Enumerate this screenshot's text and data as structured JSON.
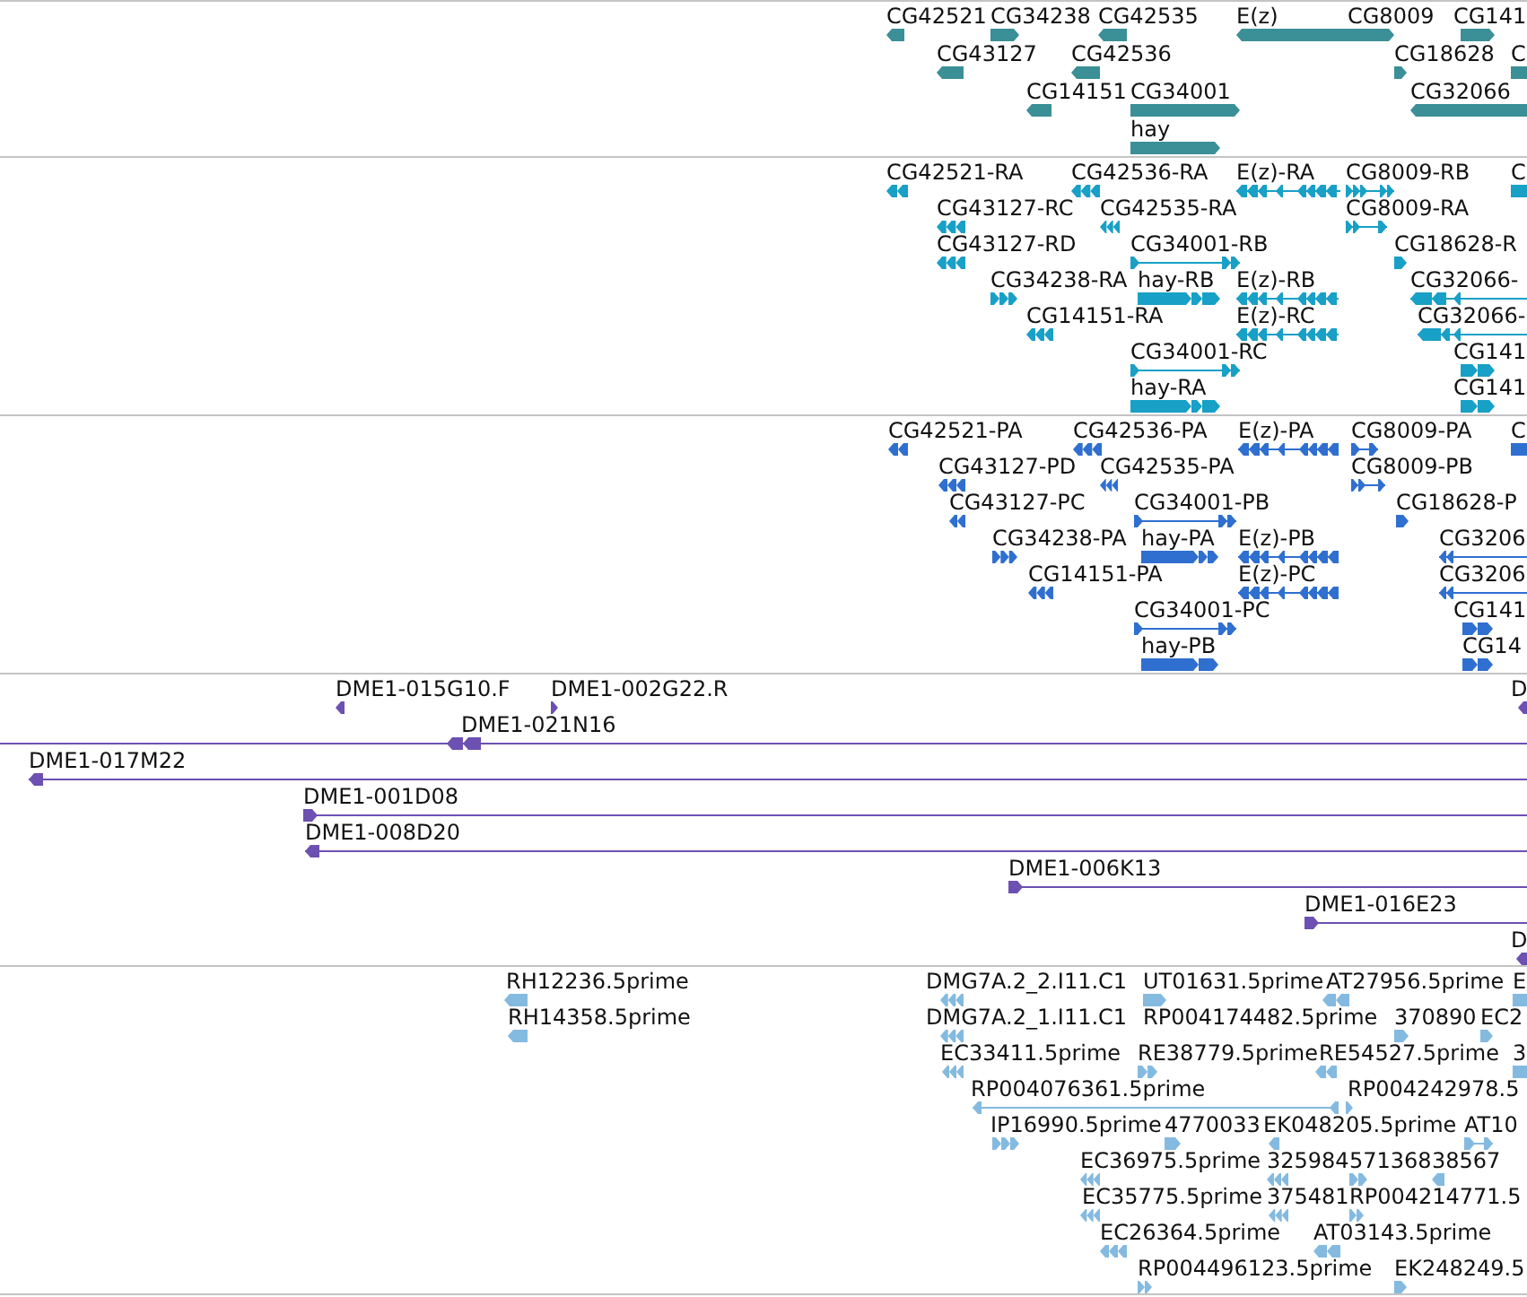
{
  "tracks": [
    {
      "color": "#3b8f96",
      "features": [
        {
          "label": "CG42521",
          "reverse": true
        },
        {
          "label": "CG34238",
          "reverse": false
        },
        {
          "label": "CG42535",
          "reverse": true
        },
        {
          "label": "E(z)",
          "reverse": true
        },
        {
          "label": "CG8009",
          "reverse": false
        },
        {
          "label": "CG141",
          "reverse": false
        },
        {
          "label": "CG43127",
          "reverse": true
        },
        {
          "label": "CG42536",
          "reverse": true
        },
        {
          "label": "CG18628",
          "reverse": false
        },
        {
          "label": "C"
        },
        {
          "label": "CG14151",
          "reverse": true
        },
        {
          "label": "CG34001",
          "reverse": false
        },
        {
          "label": "CG32066",
          "reverse": true
        },
        {
          "label": "hay",
          "reverse": false
        }
      ]
    },
    {
      "color": "#18a0c6",
      "features": [
        {
          "label": "CG42521-RA",
          "reverse": true
        },
        {
          "label": "CG42536-RA",
          "reverse": true
        },
        {
          "label": "E(z)-RA",
          "reverse": true
        },
        {
          "label": "CG8009-RB",
          "reverse": false
        },
        {
          "label": "C"
        },
        {
          "label": "CG43127-RC",
          "reverse": true
        },
        {
          "label": "CG42535-RA",
          "reverse": true
        },
        {
          "label": "CG8009-RA",
          "reverse": false
        },
        {
          "label": "CG43127-RD",
          "reverse": true
        },
        {
          "label": "CG34001-RB",
          "reverse": false
        },
        {
          "label": "CG18628-R",
          "reverse": false
        },
        {
          "label": "CG34238-RA",
          "reverse": false
        },
        {
          "label": "hay-RB",
          "reverse": false
        },
        {
          "label": "E(z)-RB",
          "reverse": true
        },
        {
          "label": "CG32066-",
          "reverse": true
        },
        {
          "label": "CG14151-RA",
          "reverse": true
        },
        {
          "label": "E(z)-RC",
          "reverse": true
        },
        {
          "label": "CG32066-",
          "reverse": true
        },
        {
          "label": "CG34001-RC",
          "reverse": false
        },
        {
          "label": "CG141",
          "reverse": false
        },
        {
          "label": "hay-RA",
          "reverse": false
        },
        {
          "label": "CG141",
          "reverse": false
        }
      ]
    },
    {
      "color": "#2f6fd0",
      "features": [
        {
          "label": "CG42521-PA",
          "reverse": true
        },
        {
          "label": "CG42536-PA",
          "reverse": true
        },
        {
          "label": "E(z)-PA",
          "reverse": true
        },
        {
          "label": "CG8009-PA",
          "reverse": false
        },
        {
          "label": "C"
        },
        {
          "label": "CG43127-PD",
          "reverse": true
        },
        {
          "label": "CG42535-PA",
          "reverse": true
        },
        {
          "label": "CG8009-PB",
          "reverse": false
        },
        {
          "label": "CG43127-PC",
          "reverse": true
        },
        {
          "label": "CG34001-PB",
          "reverse": false
        },
        {
          "label": "CG18628-P",
          "reverse": false
        },
        {
          "label": "CG34238-PA",
          "reverse": false
        },
        {
          "label": "hay-PA",
          "reverse": false
        },
        {
          "label": "E(z)-PB",
          "reverse": true
        },
        {
          "label": "CG3206",
          "reverse": true
        },
        {
          "label": "CG14151-PA",
          "reverse": true
        },
        {
          "label": "E(z)-PC",
          "reverse": true
        },
        {
          "label": "CG3206",
          "reverse": true
        },
        {
          "label": "CG34001-PC",
          "reverse": false
        },
        {
          "label": "CG141",
          "reverse": false
        },
        {
          "label": "hay-PB",
          "reverse": false
        },
        {
          "label": "CG14",
          "reverse": false
        }
      ]
    },
    {
      "color": "#6c50b2",
      "features": [
        {
          "label": "DME1-015G10.F",
          "reverse": true
        },
        {
          "label": "DME1-002G22.R",
          "reverse": false
        },
        {
          "label": "D",
          "reverse": true
        },
        {
          "label": "DME1-021N16",
          "reverse": true
        },
        {
          "label": "DME1-017M22",
          "reverse": true
        },
        {
          "label": "DME1-001D08",
          "reverse": false
        },
        {
          "label": "DME1-008D20",
          "reverse": true
        },
        {
          "label": "DME1-006K13",
          "reverse": false
        },
        {
          "label": "DME1-016E23",
          "reverse": false
        },
        {
          "label": "D",
          "reverse": true
        }
      ]
    },
    {
      "color": "#84bae0",
      "features": [
        {
          "label": "RH12236.5prime",
          "reverse": true
        },
        {
          "label": "DMG7A.2_2.I11.C1",
          "reverse": true
        },
        {
          "label": "UT01631.5prime",
          "reverse": false
        },
        {
          "label": "AT27956.5prime",
          "reverse": true
        },
        {
          "label": "E"
        },
        {
          "label": "RH14358.5prime",
          "reverse": true
        },
        {
          "label": "DMG7A.2_1.I11.C1",
          "reverse": true
        },
        {
          "label": "RP004174482.5prime"
        },
        {
          "label": "370890",
          "reverse": false
        },
        {
          "label": "EC2",
          "reverse": false
        },
        {
          "label": "EC33411.5prime",
          "reverse": true
        },
        {
          "label": "RE38779.5prime",
          "reverse": false
        },
        {
          "label": "RE54527.5prime",
          "reverse": true
        },
        {
          "label": "3"
        },
        {
          "label": "RP004076361.5prime",
          "reverse": true
        },
        {
          "label": "RP004242978.5",
          "reverse": false
        },
        {
          "label": "IP16990.5prime",
          "reverse": false
        },
        {
          "label": "4770033",
          "reverse": false
        },
        {
          "label": "EK048205.5prime",
          "reverse": true
        },
        {
          "label": "AT10",
          "reverse": false
        },
        {
          "label": "EC36975.5prime",
          "reverse": true
        },
        {
          "label": "325984",
          "reverse": true
        },
        {
          "label": "571368",
          "reverse": false
        },
        {
          "label": "38567",
          "reverse": true
        },
        {
          "label": "EC35775.5prime",
          "reverse": true
        },
        {
          "label": "375481",
          "reverse": true
        },
        {
          "label": "RP004214771.5",
          "reverse": false
        },
        {
          "label": "EC26364.5prime",
          "reverse": true
        },
        {
          "label": "AT03143.5prime",
          "reverse": true
        },
        {
          "label": "RP004496123.5prime",
          "reverse": false
        },
        {
          "label": "EK248249.5",
          "reverse": false
        }
      ]
    }
  ]
}
